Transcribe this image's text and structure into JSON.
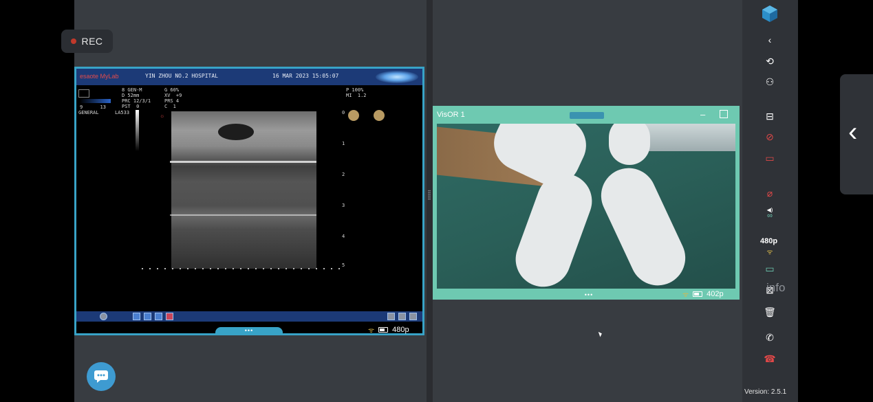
{
  "recording": {
    "label": "REC"
  },
  "ultrasound": {
    "brand": "esaote MyLab",
    "hospital": "YIN  ZHOU NO.2 HOSPITAL",
    "datetime": "16 MAR 2023 15:05:07",
    "params_left": "8 GEN-M\nD 52mm\nPRC 12/3/1\nPST  0",
    "params_mid": "G 60%\nXV  +9\nPRS 4\nC  1",
    "params_right": "P 100%\nMI  1.2",
    "preset": "GENERAL",
    "probe": "LA533",
    "scale_nums": "9      13",
    "depth_labels": [
      "0",
      "1",
      "2",
      "3",
      "4",
      "5"
    ],
    "resolution": "480p"
  },
  "visor": {
    "title": "VisOR 1",
    "resolution": "402p"
  },
  "toolbar": {
    "icons": [
      "logo-icon",
      "chevron-left-icon",
      "rotate-camera-icon",
      "add-user-icon",
      "layout-icon",
      "camera-off-icon",
      "screen-share-off-icon",
      "mic-off-icon",
      "glasses-icon",
      "battery-icon",
      "grid-off-icon",
      "trash-icon",
      "call-transfer-icon",
      "hang-up-icon"
    ],
    "resolution": "480p",
    "info_label": "info",
    "version": "Version: 2.5.1"
  },
  "colors": {
    "ultrasound_border": "#38a3c7",
    "visor_border": "#6ec9b1",
    "chat_button": "#3e9bd1",
    "alert_red": "#e04848"
  }
}
